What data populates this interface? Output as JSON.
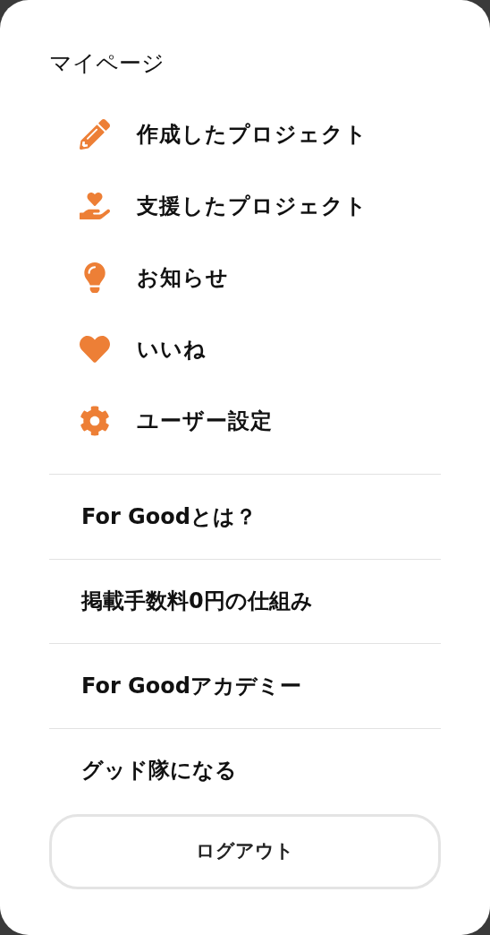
{
  "heading": "マイページ",
  "menu": [
    {
      "kind": "pencil",
      "label": "作成したプロジェクト"
    },
    {
      "kind": "hand-heart",
      "label": "支援したプロジェクト"
    },
    {
      "kind": "lightbulb",
      "label": "お知らせ"
    },
    {
      "kind": "heart",
      "label": "いいね"
    },
    {
      "kind": "gear",
      "label": "ユーザー設定"
    }
  ],
  "links": [
    "For Goodとは？",
    "掲載手数料0円の仕組み",
    "For Goodアカデミー",
    "グッド隊になる"
  ],
  "logout_button": "ログアウト"
}
